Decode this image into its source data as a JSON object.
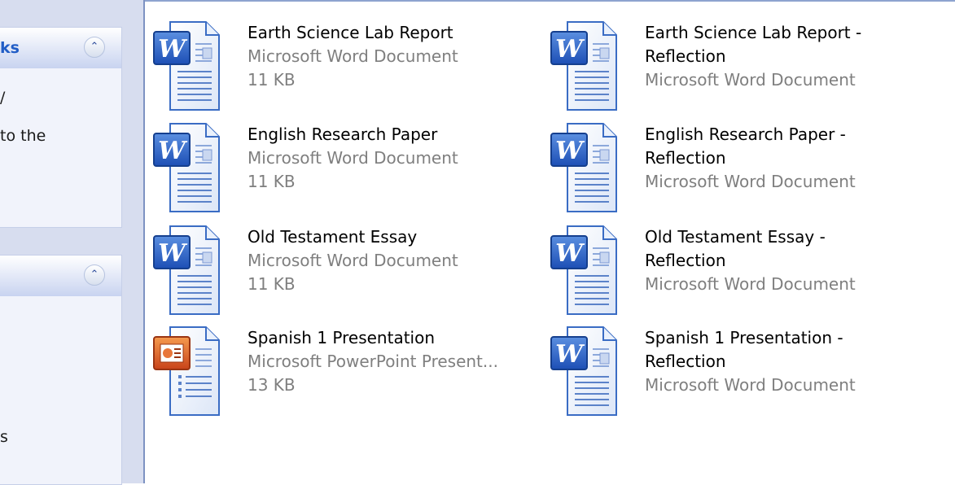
{
  "sidebar": {
    "panels": [
      {
        "title_fragment": "ks",
        "lines": [
          "/",
          "to the"
        ]
      },
      {
        "title_fragment": "",
        "lines": [
          "s"
        ]
      }
    ]
  },
  "files": [
    {
      "lines": [
        "Earth Science Lab Report",
        "Microsoft Word Document",
        "11 KB"
      ],
      "icon": "word-document-icon"
    },
    {
      "lines": [
        "Earth Science Lab Report -",
        "Reflection",
        "Microsoft Word Document"
      ],
      "icon": "word-document-icon"
    },
    {
      "lines": [
        "English Research Paper",
        "Microsoft Word Document",
        "11 KB"
      ],
      "icon": "word-document-icon"
    },
    {
      "lines": [
        "English Research Paper -",
        "Reflection",
        "Microsoft Word Document"
      ],
      "icon": "word-document-icon"
    },
    {
      "lines": [
        "Old Testament Essay",
        "Microsoft Word Document",
        "11 KB"
      ],
      "icon": "word-document-icon"
    },
    {
      "lines": [
        "Old Testament Essay -",
        "Reflection",
        "Microsoft Word Document"
      ],
      "icon": "word-document-icon"
    },
    {
      "lines": [
        "Spanish 1 Presentation",
        "Microsoft PowerPoint Present...",
        "13 KB"
      ],
      "icon": "powerpoint-document-icon"
    },
    {
      "lines": [
        "Spanish 1 Presentation -",
        "Reflection",
        "Microsoft Word Document"
      ],
      "icon": "word-document-icon"
    }
  ],
  "colors": {
    "link_blue": "#215dc6",
    "meta_gray": "#7f7f7f",
    "pane_background": "#d7ddef"
  }
}
